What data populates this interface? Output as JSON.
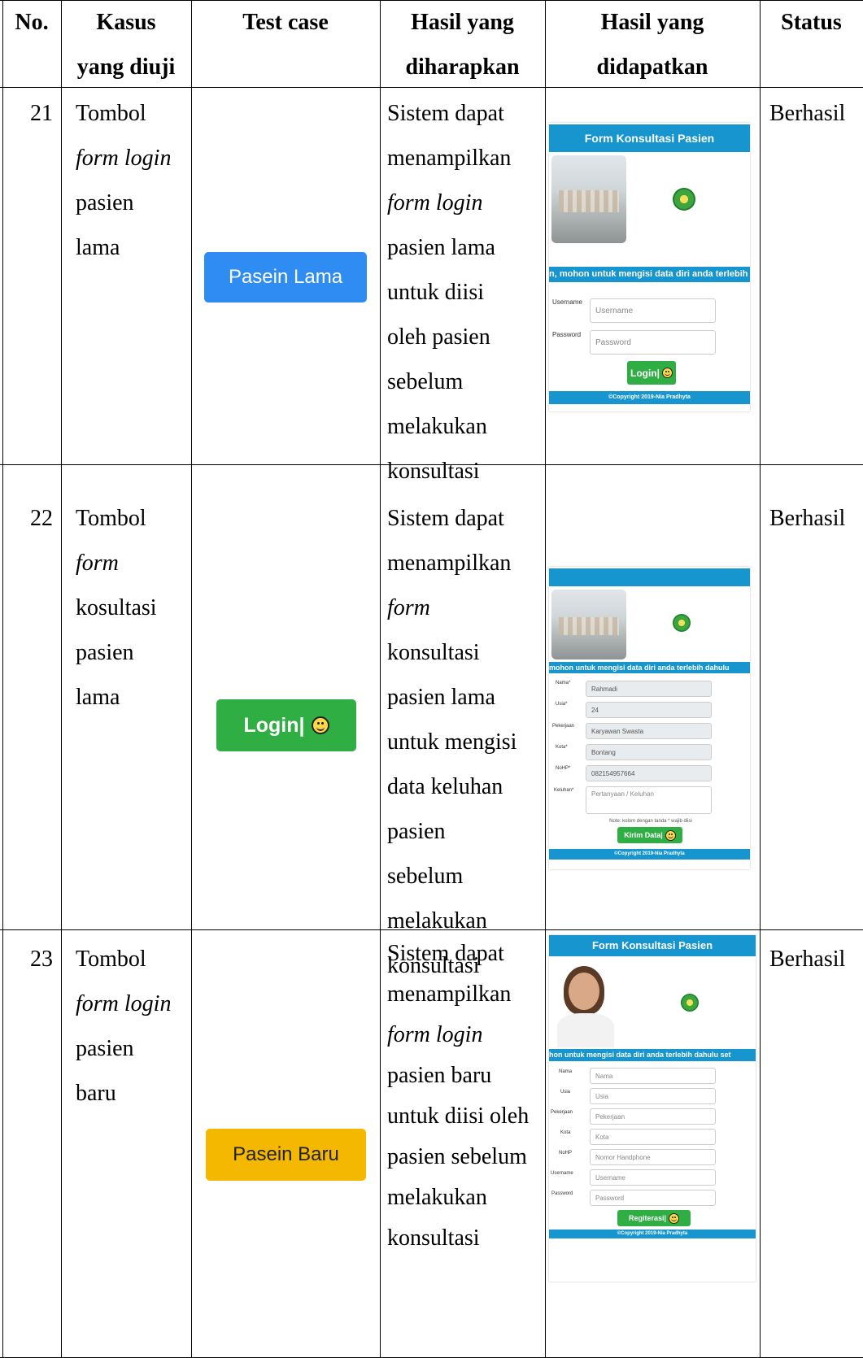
{
  "headers": {
    "no": "No.",
    "kasus_1": "Kasus",
    "kasus_2": "yang diuji",
    "test_case": "Test case",
    "harap_1": "Hasil yang",
    "harap_2": "diharapkan",
    "dapat_1": "Hasil yang",
    "dapat_2": "didapatkan",
    "status": "Status"
  },
  "rows": [
    {
      "no": "21",
      "kasus": [
        "Tombol",
        "form login",
        "pasien",
        "lama"
      ],
      "button_label": "Pasein Lama",
      "harap": [
        "Sistem dapat",
        "menampilkan",
        "form login",
        "pasien lama",
        "untuk diisi",
        "oleh pasien",
        "sebelum",
        "melakukan",
        "konsultasi"
      ],
      "status": "Berhasil",
      "shot": {
        "title": "Form Konsultasi Pasien",
        "banner": "n, mohon untuk mengisi data diri anda terlebih dahulu",
        "username_label": "Username",
        "username_ph": "Username",
        "password_label": "Password",
        "password_ph": "Password",
        "button": "Login|",
        "footer": "©Copyright 2019-Nia Pradhyta"
      }
    },
    {
      "no": "22",
      "kasus": [
        "Tombol",
        "form",
        "kosultasi",
        "pasien",
        "lama"
      ],
      "button_label": "Login|",
      "harap": [
        "Sistem dapat",
        "menampilkan",
        "form",
        "konsultasi",
        "pasien lama",
        "untuk mengisi",
        "data keluhan",
        "pasien",
        "sebelum",
        "melakukan",
        "konsultasi"
      ],
      "status": "Berhasil",
      "shot": {
        "banner": "mohon untuk mengisi data diri anda terlebih dahulu",
        "fields": [
          {
            "label": "Nama*",
            "value": "Rahmadi"
          },
          {
            "label": "Usia*",
            "value": "24"
          },
          {
            "label": "Pekerjaan",
            "value": "Karyawan Swasta"
          },
          {
            "label": "Kota*",
            "value": "Bontang"
          },
          {
            "label": "NoHP*",
            "value": "082154957664"
          }
        ],
        "keluhan_label": "Keluhan*",
        "keluhan_ph": "Pertanyaan / Keluhan",
        "note": "Note: kolom dengan tanda * wajib diisi",
        "button": "Kirim Data|",
        "footer": "©Copyright 2019-Nia Pradhyta"
      }
    },
    {
      "no": "23",
      "kasus": [
        "Tombol",
        "form login",
        "pasien",
        "baru"
      ],
      "button_label": "Pasein Baru",
      "harap": [
        "Sistem dapat",
        "menampilkan",
        "form login",
        "pasien baru",
        "untuk diisi oleh",
        "pasien sebelum",
        "melakukan",
        "konsultasi"
      ],
      "status": "Berhasil",
      "shot": {
        "title": "Form Konsultasi Pasien",
        "banner": "hon untuk mengisi data diri anda terlebih dahulu set",
        "fields": [
          {
            "label": "Nama",
            "placeholder": "Nama"
          },
          {
            "label": "Usia",
            "placeholder": "Usia"
          },
          {
            "label": "Pekerjaan",
            "placeholder": "Pekerjaan"
          },
          {
            "label": "Kota",
            "placeholder": "Kota"
          },
          {
            "label": "NoHP",
            "placeholder": "Nomor Handphone"
          },
          {
            "label": "Username",
            "placeholder": "Username"
          },
          {
            "label": "Password",
            "placeholder": "Password"
          }
        ],
        "button": "Regiterasi|",
        "footer": "©Copyright 2019-Nia Pradhyta"
      }
    }
  ]
}
